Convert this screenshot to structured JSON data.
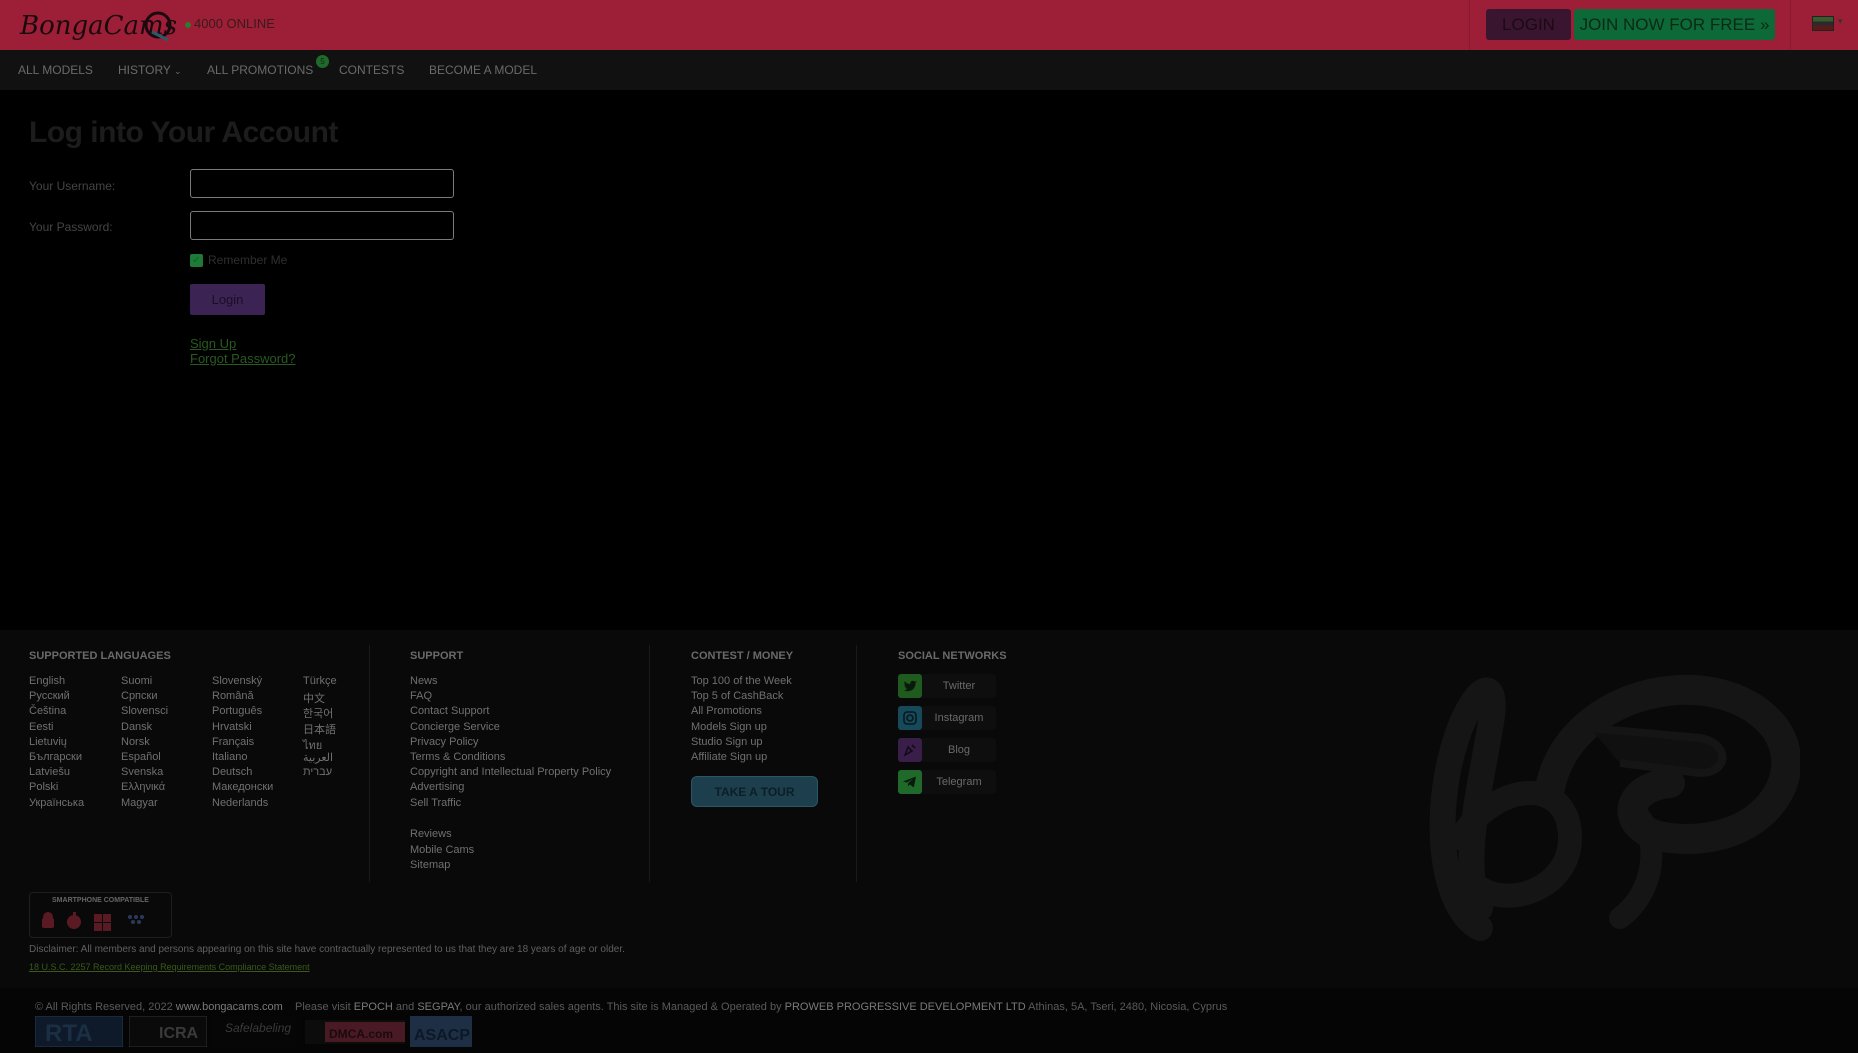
{
  "header": {
    "brand": "BongaCams",
    "online_count": "4000 ONLINE",
    "login_label": "LOGIN",
    "join_label": "JOIN NOW FOR FREE »",
    "flag_icon": "flag-us-icon"
  },
  "nav": {
    "items": [
      "ALL MODELS",
      "HISTORY",
      "ALL PROMOTIONS",
      "CONTESTS",
      "BECOME A MODEL"
    ],
    "promotions_badge": "5"
  },
  "login": {
    "title": "Log into Your Account",
    "username_label": "Your Username:",
    "password_label": "Your Password:",
    "remember_label": "Remember Me",
    "submit_label": "Login",
    "signup_label": "Sign Up",
    "forgot_label": "Forgot Password?"
  },
  "footer": {
    "languages_title": "SUPPORTED LANGUAGES",
    "languages": [
      [
        "English",
        "Русский",
        "Čeština",
        "Eesti",
        "Lietuvių",
        "Български",
        "Latviešu",
        "Polski",
        "Українська"
      ],
      [
        "Suomi",
        "Српски",
        "Slovensci",
        "Dansk",
        "Norsk",
        "Español",
        "Svenska",
        "Ελληνικά",
        "Magyar"
      ],
      [
        "Slovenský",
        "Română",
        "Português",
        "Hrvatski",
        "Français",
        "Italiano",
        "Deutsch",
        "Македонски",
        "Nederlands"
      ],
      [
        "Türkçe",
        "中文",
        "한국어",
        "日本語",
        "ไทย",
        "العربية",
        "עברית"
      ]
    ],
    "support_title": "SUPPORT",
    "support_links": [
      "News",
      "FAQ",
      "Contact Support",
      "Concierge Service",
      "Privacy Policy",
      "Terms & Conditions",
      "Copyright and Intellectual Property Policy",
      "Advertising",
      "Sell Traffic"
    ],
    "support_links_2": [
      "Reviews",
      "Mobile Cams",
      "Sitemap"
    ],
    "contest_title": "CONTEST / MONEY",
    "contest_links": [
      "Top 100 of the Week",
      "Top 5 of CashBack",
      "All Promotions",
      "Models Sign up",
      "Studio Sign up",
      "Affiliate Sign up"
    ],
    "tour_label": "TAKE A TOUR",
    "social_title": "SOCIAL NETWORKS",
    "social": [
      {
        "label": "Twitter",
        "icon": "twitter-icon",
        "color": "#1f5a1f"
      },
      {
        "label": "Instagram",
        "icon": "instagram-icon",
        "color": "#164a5a"
      },
      {
        "label": "Blog",
        "icon": "blog-icon",
        "color": "#3a1e4a"
      },
      {
        "label": "Telegram",
        "icon": "telegram-icon",
        "color": "#1f6a2a"
      }
    ],
    "smartphone_title": "SMARTPHONE COMPATIBLE",
    "disclaimer": "Disclaimer: All members and persons appearing on this site have contractually represented to us that they are 18 years of age or older.",
    "usc_link": "18 U.S.C. 2257 Record Keeping Requirements Compliance Statement",
    "copyright_a": "© All Rights Reserved, 2022",
    "copyright_site": "www.bongacams.com",
    "copyright_b": "Please visit",
    "epoch": "EPOCH",
    "and": "and",
    "segpay": "SEGPAY",
    "copyright_c": ", our authorized sales agents. This site is Managed & Operated by",
    "company": "PROWEB PROGRESSIVE DEVELOPMENT LTD",
    "address": "Athinas, 5A, Tseri, 2480, Nicosia, Cyprus",
    "badges": [
      "RTA",
      "ICRA",
      "Safelabeling",
      "DMCA.com",
      "ASACP"
    ]
  }
}
